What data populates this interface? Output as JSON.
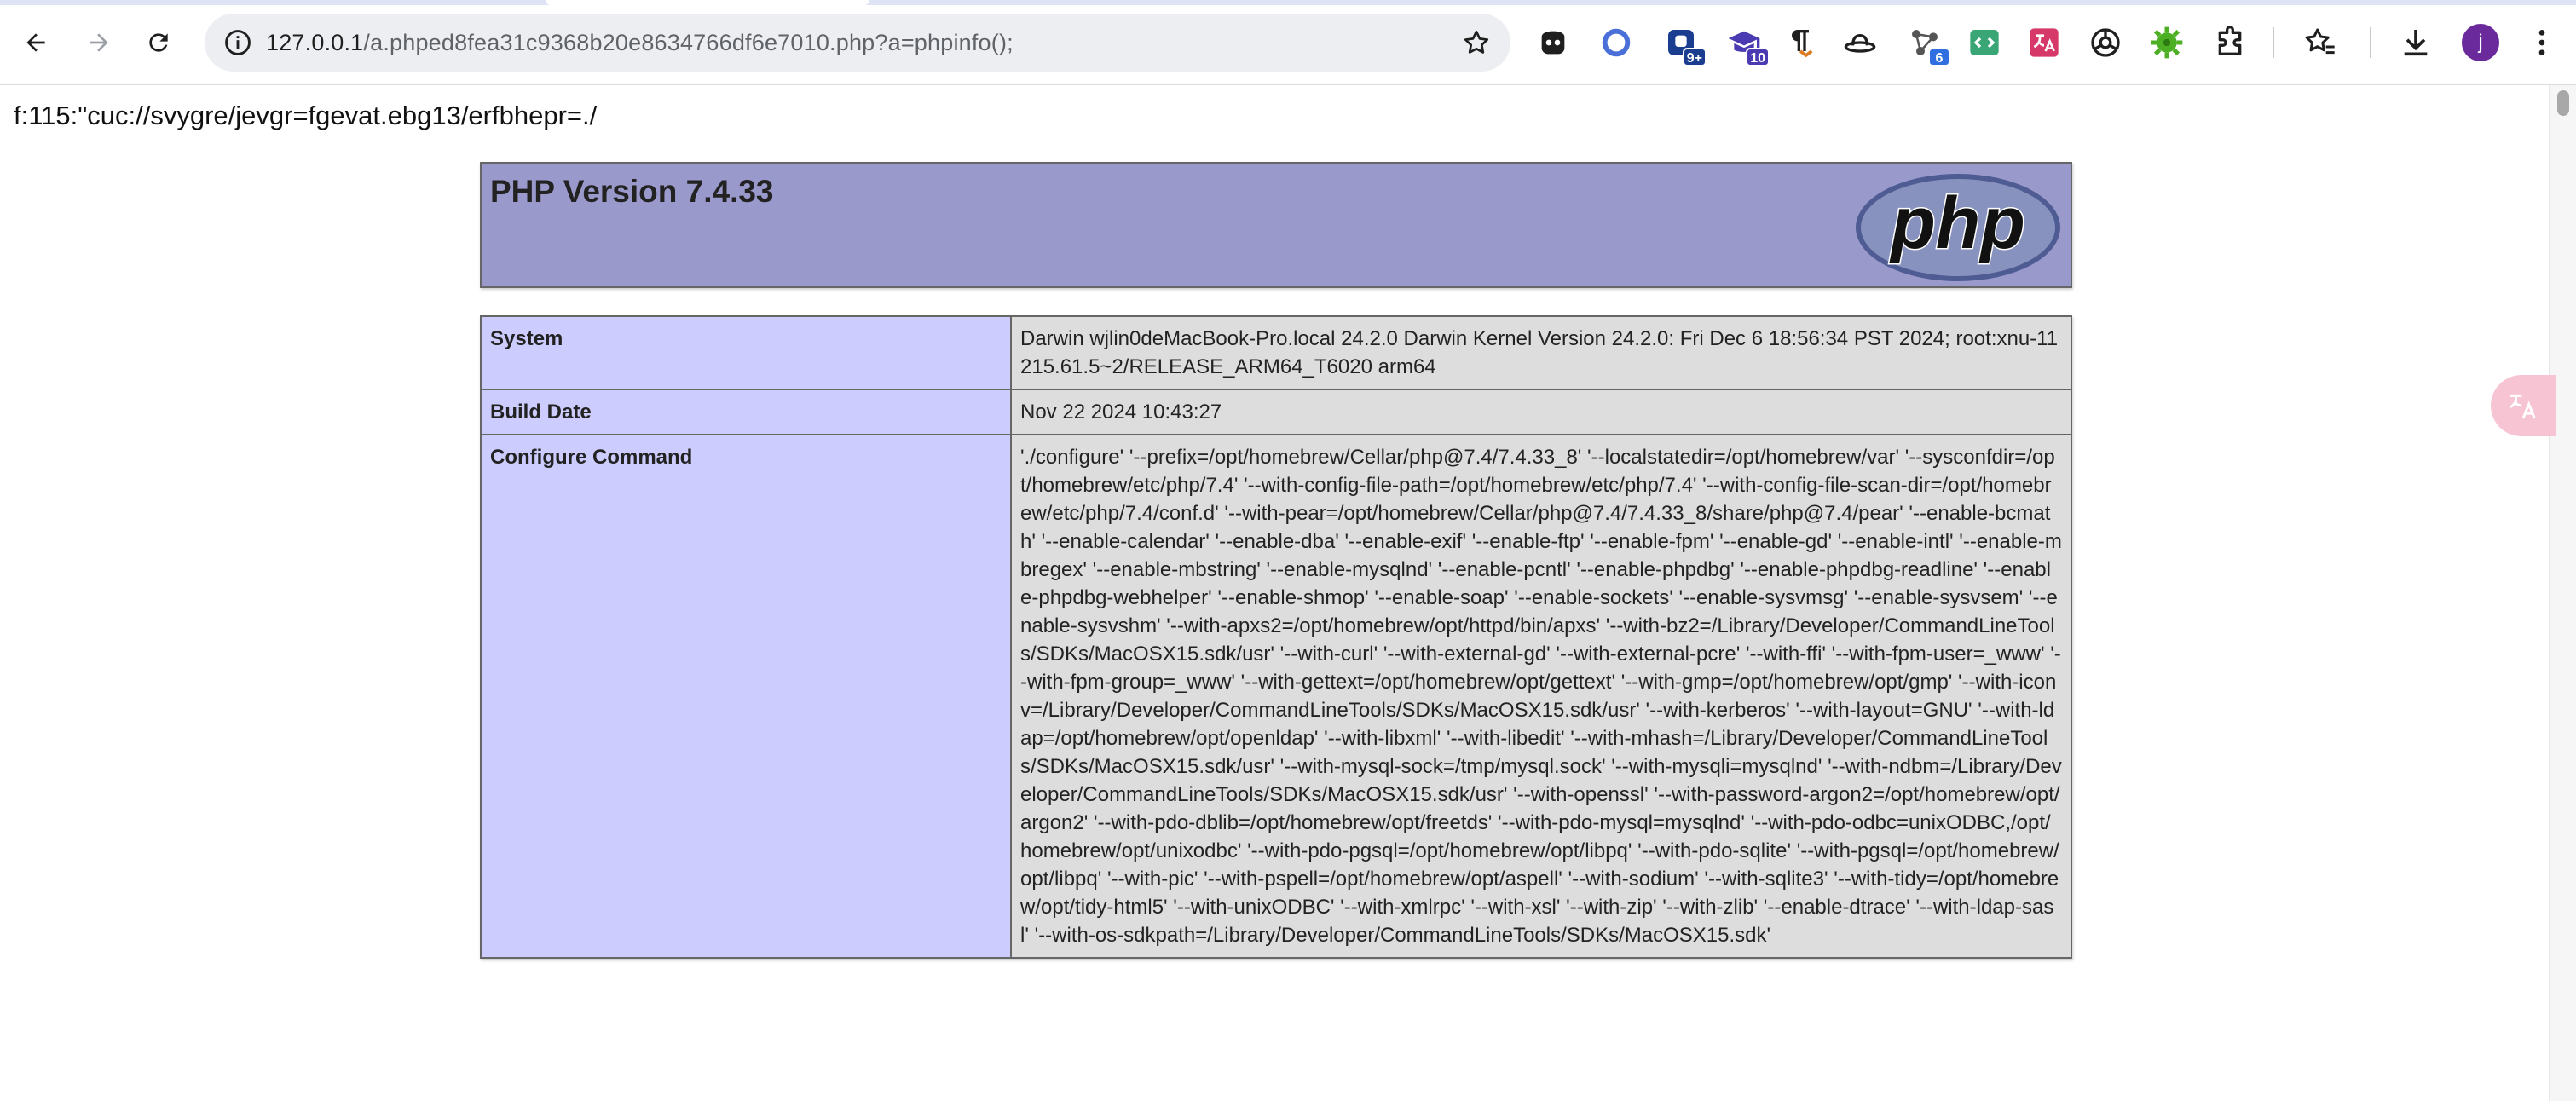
{
  "browser": {
    "url_host": "127.0.0.1",
    "url_path": "/a.phped8fea31c9368b20e8634766df6e7010.php?a=phpinfo();",
    "extensions": [
      {
        "icon": "ghost-mask-icon"
      },
      {
        "icon": "circle-ring-icon"
      },
      {
        "icon": "shield-badge-icon",
        "badge": "9+",
        "badge_color": "#1a3d8f"
      },
      {
        "icon": "graduation-cap-icon",
        "badge": "10",
        "badge_color": "#4b3bb3"
      },
      {
        "icon": "pilcrow-arrow-icon"
      },
      {
        "icon": "hat-icon"
      },
      {
        "icon": "network-nodes-icon",
        "badge": "6",
        "badge_color": "#2f6fe0"
      },
      {
        "icon": "code-tag-icon"
      },
      {
        "icon": "translate-box-icon"
      },
      {
        "icon": "disc-icon"
      },
      {
        "icon": "gear-green-icon"
      },
      {
        "icon": "puzzle-icon"
      }
    ],
    "profile_initial": "j"
  },
  "page": {
    "rot13_line": "f:115:\"cuc://svygre/jevgr=fgevat.ebg13/erfbhepr=./",
    "php_version_title": "PHP Version 7.4.33",
    "logo_text": "php",
    "rows": [
      {
        "label": "System",
        "value": "Darwin wjlin0deMacBook-Pro.local 24.2.0 Darwin Kernel Version 24.2.0: Fri Dec 6 18:56:34 PST 2024; root:xnu-11215.61.5~2/RELEASE_ARM64_T6020 arm64"
      },
      {
        "label": "Build Date",
        "value": "Nov 22 2024 10:43:27"
      },
      {
        "label": "Configure Command",
        "value": "'./configure' '--prefix=/opt/homebrew/Cellar/php@7.4/7.4.33_8' '--localstatedir=/opt/homebrew/var' '--sysconfdir=/opt/homebrew/etc/php/7.4' '--with-config-file-path=/opt/homebrew/etc/php/7.4' '--with-config-file-scan-dir=/opt/homebrew/etc/php/7.4/conf.d' '--with-pear=/opt/homebrew/Cellar/php@7.4/7.4.33_8/share/php@7.4/pear' '--enable-bcmath' '--enable-calendar' '--enable-dba' '--enable-exif' '--enable-ftp' '--enable-fpm' '--enable-gd' '--enable-intl' '--enable-mbregex' '--enable-mbstring' '--enable-mysqlnd' '--enable-pcntl' '--enable-phpdbg' '--enable-phpdbg-readline' '--enable-phpdbg-webhelper' '--enable-shmop' '--enable-soap' '--enable-sockets' '--enable-sysvmsg' '--enable-sysvsem' '--enable-sysvshm' '--with-apxs2=/opt/homebrew/opt/httpd/bin/apxs' '--with-bz2=/Library/Developer/CommandLineTools/SDKs/MacOSX15.sdk/usr' '--with-curl' '--with-external-gd' '--with-external-pcre' '--with-ffi' '--with-fpm-user=_www' '--with-fpm-group=_www' '--with-gettext=/opt/homebrew/opt/gettext' '--with-gmp=/opt/homebrew/opt/gmp' '--with-iconv=/Library/Developer/CommandLineTools/SDKs/MacOSX15.sdk/usr' '--with-kerberos' '--with-layout=GNU' '--with-ldap=/opt/homebrew/opt/openldap' '--with-libxml' '--with-libedit' '--with-mhash=/Library/Developer/CommandLineTools/SDKs/MacOSX15.sdk/usr' '--with-mysql-sock=/tmp/mysql.sock' '--with-mysqli=mysqlnd' '--with-ndbm=/Library/Developer/CommandLineTools/SDKs/MacOSX15.sdk/usr' '--with-openssl' '--with-password-argon2=/opt/homebrew/opt/argon2' '--with-pdo-dblib=/opt/homebrew/opt/freetds' '--with-pdo-mysql=mysqlnd' '--with-pdo-odbc=unixODBC,/opt/homebrew/opt/unixodbc' '--with-pdo-pgsql=/opt/homebrew/opt/libpq' '--with-pdo-sqlite' '--with-pgsql=/opt/homebrew/opt/libpq' '--with-pic' '--with-pspell=/opt/homebrew/opt/aspell' '--with-sodium' '--with-sqlite3' '--with-tidy=/opt/homebrew/opt/tidy-html5' '--with-unixODBC' '--with-xmlrpc' '--with-xsl' '--with-zip' '--with-zlib' '--enable-dtrace' '--with-ldap-sasl' '--with-os-sdkpath=/Library/Developer/CommandLineTools/SDKs/MacOSX15.sdk'"
      }
    ]
  },
  "colors": {
    "header_bg": "#9999cc",
    "label_bg": "#ccccff",
    "value_bg": "#dddddd"
  }
}
